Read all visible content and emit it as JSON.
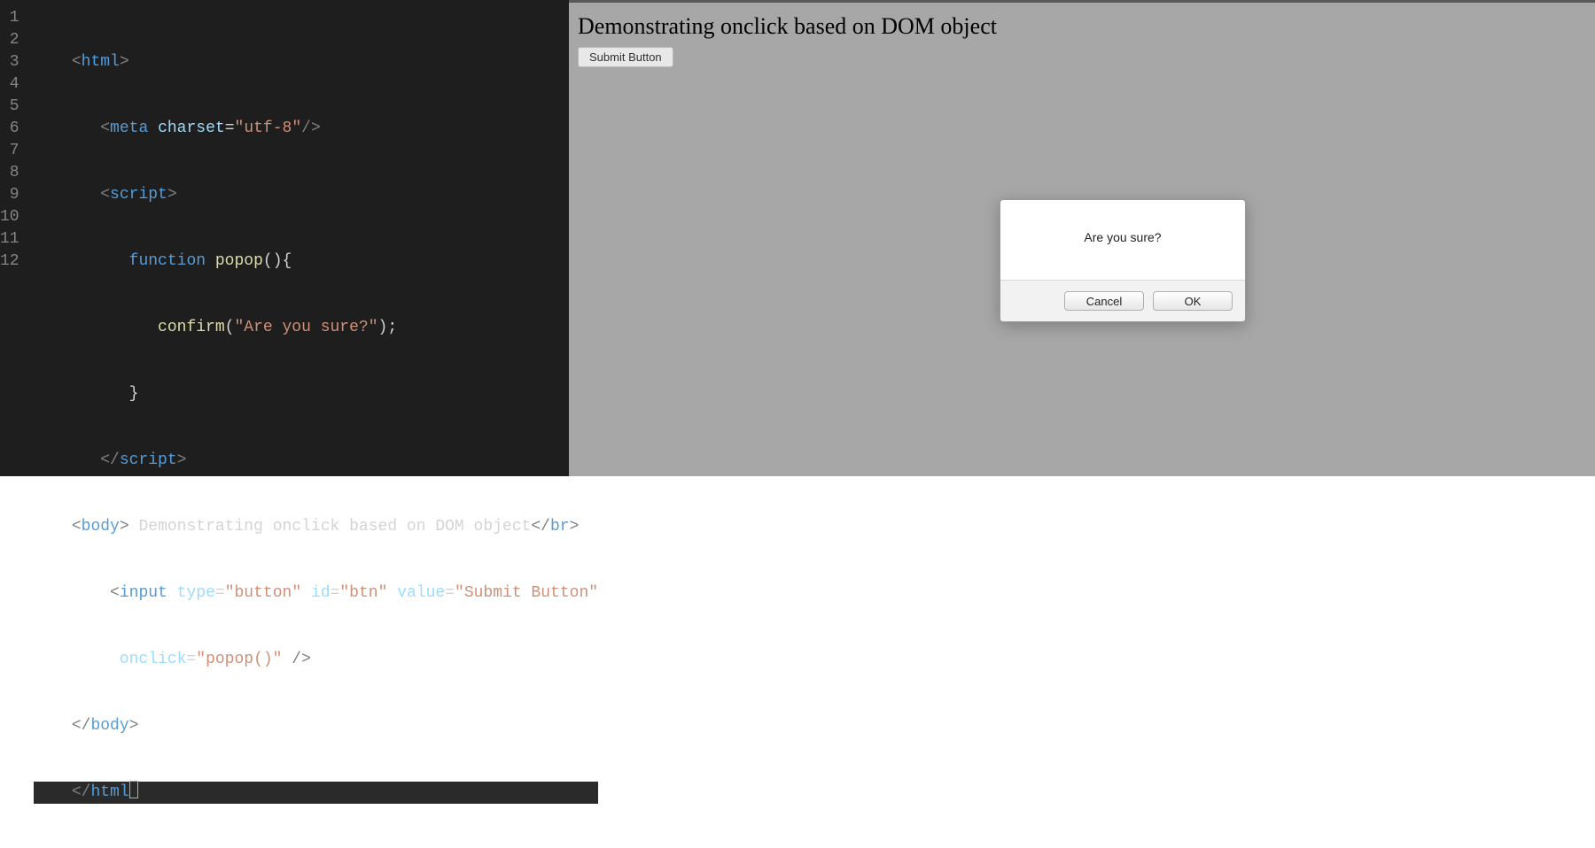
{
  "editor": {
    "line_numbers": [
      "1",
      "2",
      "3",
      "4",
      "5",
      "6",
      "7",
      "8",
      "9",
      "10",
      "11",
      "12"
    ],
    "lines": {
      "l1": {
        "open": "<",
        "tag": "html",
        "close": ">"
      },
      "l2": {
        "open": "<",
        "tag": "meta",
        "sp": " ",
        "attr": "charset",
        "eq": "=",
        "val": "\"utf-8\"",
        "slash": "/>"
      },
      "l3": {
        "open": "<",
        "tag": "script",
        "close": ">"
      },
      "l4": {
        "kw": "function",
        "sp": " ",
        "fn": "popop",
        "paren": "(){"
      },
      "l5": {
        "fn": "confirm",
        "open": "(",
        "str": "\"Are you sure?\"",
        "close": ");"
      },
      "l6": {
        "brace": "}"
      },
      "l7": {
        "open": "</",
        "tag": "script",
        "close": ">"
      },
      "l8": {
        "open": "<",
        "tag": "body",
        "close": "> ",
        "text": "Demonstrating onclick based on DOM object",
        "open2": "</",
        "tag2": "br",
        "close2": ">"
      },
      "l9": {
        "open": "<",
        "tag": "input",
        "sp": " ",
        "attr1": "type",
        "eq": "=",
        "val1": "\"button\"",
        "sp2": " ",
        "attr2": "id",
        "val2": "\"btn\"",
        "sp3": " ",
        "attr3": "value",
        "val3": "\"Submit Button\""
      },
      "l10": {
        "attr": "onclick",
        "eq": "=",
        "val": "\"popop()\"",
        "sp": " ",
        "slash": "/>"
      },
      "l11": {
        "open": "</",
        "tag": "body",
        "close": ">"
      },
      "l12": {
        "open": "</",
        "tag": "html",
        "close": ">"
      }
    }
  },
  "browser": {
    "heading": "Demonstrating onclick based on DOM object",
    "button_label": "Submit Button"
  },
  "dialog": {
    "message": "Are you sure?",
    "cancel": "Cancel",
    "ok": "OK"
  }
}
